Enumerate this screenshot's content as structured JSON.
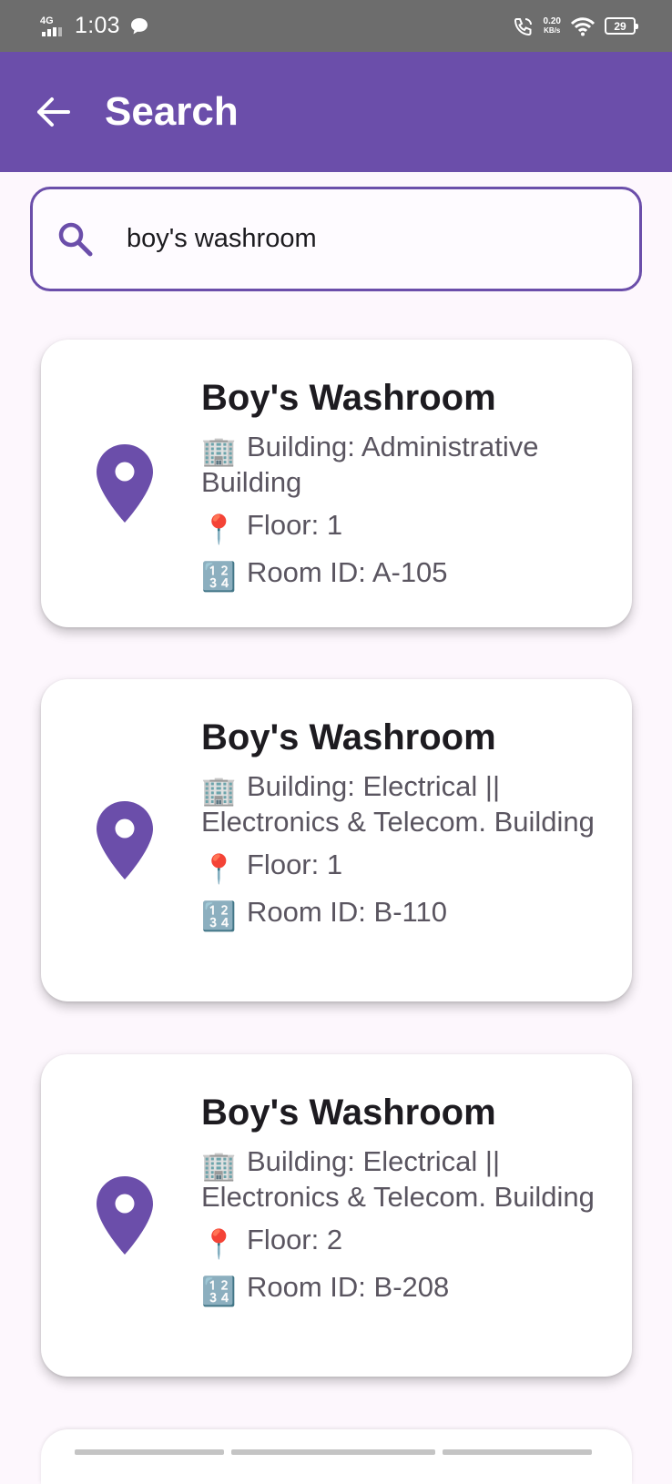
{
  "status_bar": {
    "time": "1:03",
    "network": "4G",
    "speed_value": "0.20",
    "speed_unit": "KB/s",
    "battery": "29"
  },
  "app_bar": {
    "title": "Search",
    "back_icon": "arrow-left-icon"
  },
  "search": {
    "icon": "search-icon",
    "value": "boy's washroom"
  },
  "results": [
    {
      "title": "Boy's Washroom",
      "building_emoji": "🏢",
      "building": "Building: Administrative Building",
      "floor_emoji": "📍",
      "floor": "Floor: 1",
      "room_emoji": "🔢",
      "room": "Room ID: A-105"
    },
    {
      "title": "Boy's Washroom",
      "building_emoji": "🏢",
      "building": "Building: Electrical || Electronics & Telecom. Building",
      "floor_emoji": "📍",
      "floor": "Floor: 1",
      "room_emoji": "🔢",
      "room": "Room ID: B-110"
    },
    {
      "title": "Boy's Washroom",
      "building_emoji": "🏢",
      "building": "Building: Electrical || Electronics & Telecom. Building",
      "floor_emoji": "📍",
      "floor": "Floor: 2",
      "room_emoji": "🔢",
      "room": "Room ID: B-208"
    }
  ],
  "colors": {
    "primary": "#6b4eaa",
    "status_bar": "#6d6d6d",
    "background": "#fdf7fd"
  }
}
